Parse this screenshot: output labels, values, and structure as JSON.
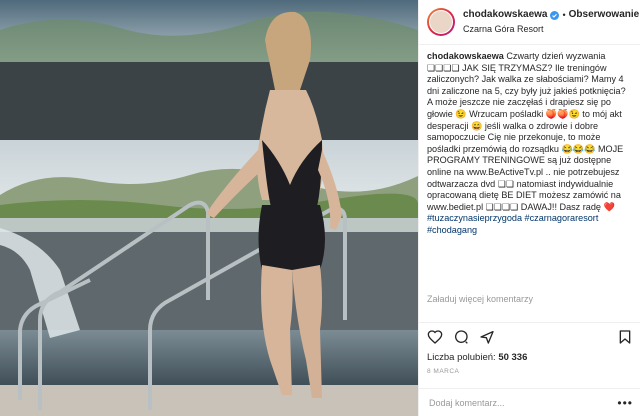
{
  "post": {
    "username": "chodakowskaewa",
    "separator": "•",
    "follow_label": "Obserwowanie",
    "location": "Czarna Góra Resort"
  },
  "caption": {
    "author": "chodakowskaewa",
    "text": "Czwarty dzień wyzwania ❏❏❏❏ JAK SIĘ TRZYMASZ? Ile treningów zaliczonych? Jak walka ze słabościami? Mamy 4 dni zaliczone na 5, czy były już jakieś potknięcia? A może jeszcze nie zaczęłaś i drapiesz się po głowie 😉 Wrzucam pośladki 🍑🍑😉 to mój akt desperacji 😄 jeśli walka o zdrowie i dobre samopoczucie Cię nie przekonuje, to może pośladki przemówią do rozsądku 😂😂😂 MOJE PROGRAMY TRENINGOWE są już dostępne online na www.BeActiveTv.pl .. nie potrzebujesz odtwarzacza dvd ❏❏ natomiast indywidualnie opracowaną dietę BE DIET możesz zamówić na www.bediet.pl ❏❏❏❏ DAWAJ!! Dasz radę ❤️",
    "hashtags": "#tuzaczynasieprzygoda #czarnagoraresort #chodagang"
  },
  "load_more_label": "Załaduj więcej komentarzy",
  "likes": {
    "label": "Liczba polubień:",
    "count": "50 336"
  },
  "date_label": "8 MARCA",
  "comment": {
    "placeholder": "Dodaj komentarz..."
  },
  "comment_more": "•••",
  "icons": [
    "heart-icon",
    "comment-icon",
    "share-icon",
    "bookmark-icon",
    "verified-badge-icon"
  ],
  "colors": {
    "verified": "#3897f0",
    "hashtag": "#003569",
    "muted": "#999999"
  }
}
